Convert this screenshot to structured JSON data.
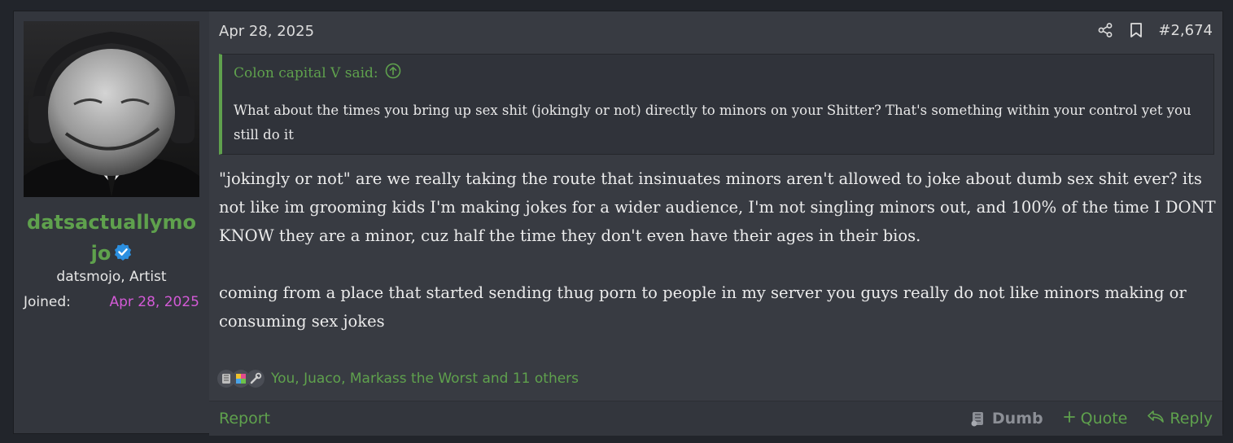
{
  "post": {
    "date": "Apr 28, 2025",
    "number": "#2,674",
    "icons": {
      "share": "share-icon",
      "bookmark": "bookmark-icon"
    }
  },
  "user": {
    "name_line1": "datsactuallymo",
    "name_line2": "jo",
    "title": "datsmojo, Artist",
    "joined_label": "Joined:",
    "joined_value": "Apr 28, 2025",
    "name_color": "#5fa14d",
    "joined_color": "#d35ad6"
  },
  "quote": {
    "attribution": "Colon capital V said:",
    "body": "What about the times you bring up sex shit (jokingly or not) directly to minors on your Shitter? That's something within your control yet you still do it"
  },
  "message": {
    "paragraph1": "\"jokingly or not\" are we really taking the route that insinuates minors aren't allowed to joke about dumb sex shit ever? its not like im grooming kids I'm making jokes for a wider audience, I'm not singling minors out, and 100% of the time I DONT KNOW they are a minor, cuz half the time they don't even have their ages in their bios.",
    "paragraph2": "coming from a place that started sending thug porn to people in my server you guys really do not like minors making or consuming sex jokes"
  },
  "reactions": {
    "users": "You, Juaco, Markass the Worst and 11 others",
    "icons": [
      "dumb-icon",
      "puzzle-icon",
      "wrench-icon"
    ]
  },
  "footer": {
    "report": "Report",
    "dumb": "Dumb",
    "quote": "Quote",
    "reply": "Reply"
  },
  "colors": {
    "accent": "#5fa14d",
    "background": "#383b42",
    "sidebar": "#33363d"
  }
}
